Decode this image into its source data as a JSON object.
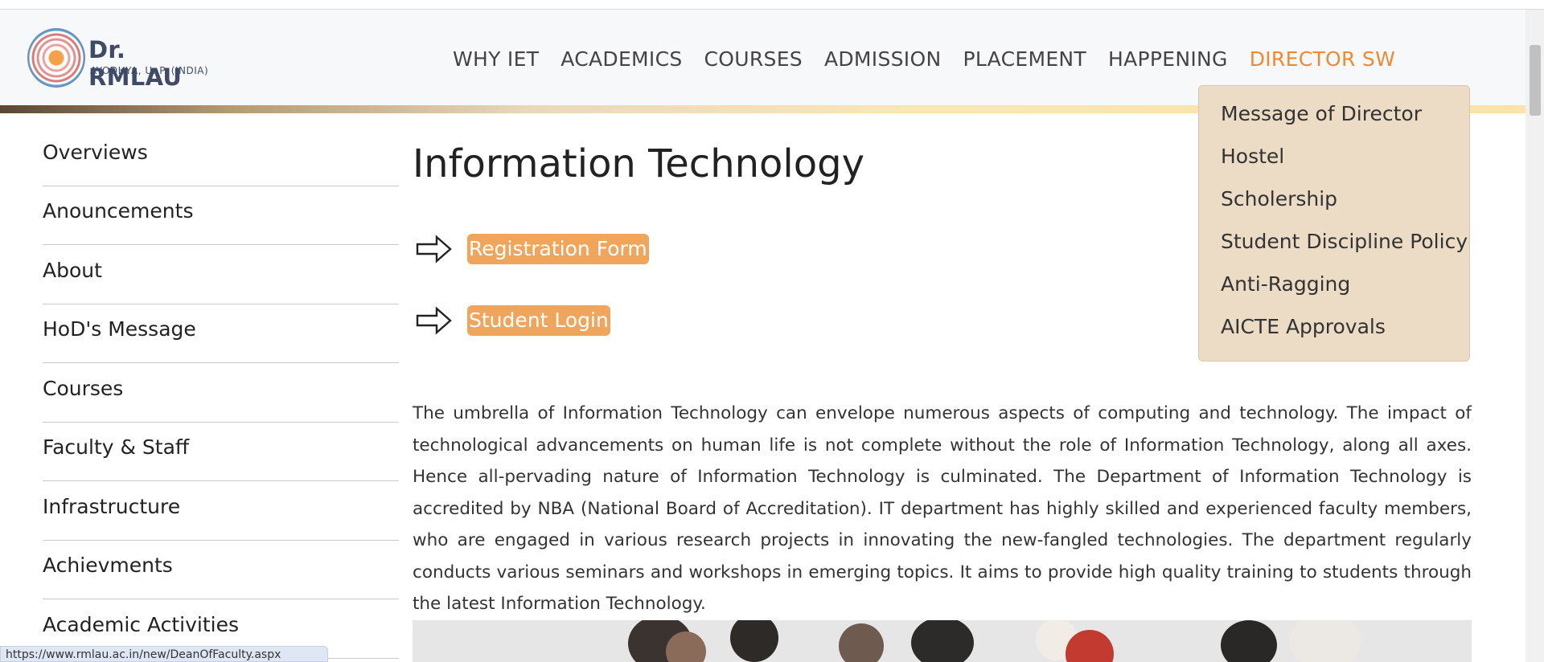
{
  "brand": {
    "title": "Dr. RMLAU",
    "subtitle": "AYODHYA, U. P. (INDIA)"
  },
  "nav": {
    "items": [
      {
        "label": "WHY IET"
      },
      {
        "label": "ACADEMICS"
      },
      {
        "label": "COURSES"
      },
      {
        "label": "ADMISSION"
      },
      {
        "label": "PLACEMENT"
      },
      {
        "label": "HAPPENING"
      },
      {
        "label": "DIRECTOR SW"
      }
    ],
    "active": "DIRECTOR SW",
    "active_color": "#ef8a33"
  },
  "dropdown": {
    "items": [
      {
        "label": "Message of Director"
      },
      {
        "label": "Hostel"
      },
      {
        "label": "Scholership"
      },
      {
        "label": "Student Discipline Policy"
      },
      {
        "label": "Anti-Ragging"
      },
      {
        "label": "AICTE Approvals"
      }
    ]
  },
  "sidebar": {
    "items": [
      {
        "label": "Overviews"
      },
      {
        "label": "Anouncements"
      },
      {
        "label": "About"
      },
      {
        "label": "HoD's Message"
      },
      {
        "label": "Courses"
      },
      {
        "label": "Faculty & Staff"
      },
      {
        "label": "Infrastructure"
      },
      {
        "label": "Achievments"
      },
      {
        "label": "Academic Activities"
      }
    ]
  },
  "main": {
    "title": "Information Technology",
    "links": [
      {
        "label": "Registration Form",
        "icon": "right-arrow-icon"
      },
      {
        "label": "Student Login",
        "icon": "right-arrow-icon"
      }
    ],
    "pill_color": "#f0a55d",
    "paragraph": "The umbrella of Information Technology can envelope numerous aspects of computing and technology. The impact of technological advancements on human life is not complete without the role of Information Technology, along all axes. Hence all-pervading nature of Information Technology is culminated. The Department of Information Technology is accredited by NBA (National Board of Accreditation). IT department has highly skilled and experienced faculty members, who are engaged in various research projects in innovating the new-fangled technologies. The department regularly conducts various seminars and workshops in emerging topics. It aims to provide high quality training to students through the latest Information Technology."
  },
  "status_bar": {
    "url": "https://www.rmlau.ac.in/new/DeanOfFaculty.aspx"
  }
}
